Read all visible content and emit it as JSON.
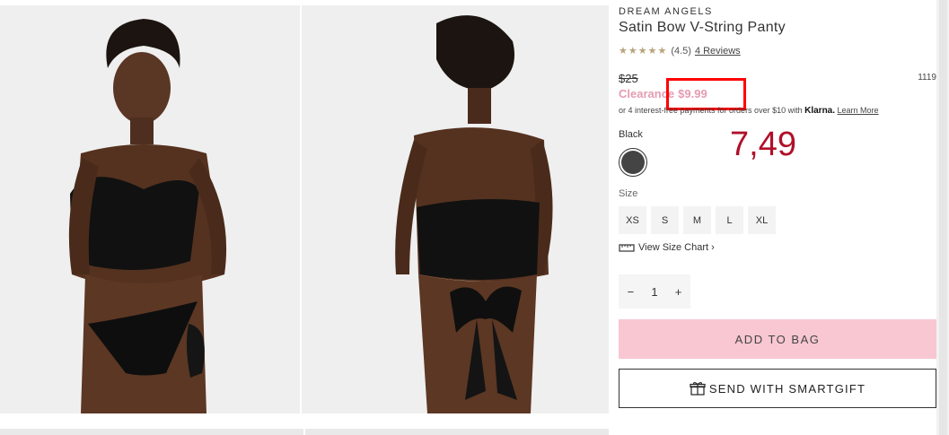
{
  "product": {
    "brand": "DREAM ANGELS",
    "title": "Satin Bow V-String Panty",
    "rating_stars": "★★★★★",
    "rating_value": "(4.5)",
    "reviews_link": "4 Reviews",
    "original_price": "$25",
    "sku": "1119",
    "clearance_label": "Clearance",
    "clearance_price": "$9.99",
    "klarna_text": "or 4 interest-free payments for orders over $10 with",
    "klarna_brand": "Klarna.",
    "klarna_link": "Learn More",
    "color_label": "Black",
    "size_label": "Size",
    "sizes": [
      "XS",
      "S",
      "M",
      "L",
      "XL"
    ],
    "size_chart_link": "View Size Chart ›",
    "quantity": "1",
    "add_to_bag": "ADD TO BAG",
    "smartgift": "SEND WITH SMARTGIFT"
  },
  "annotation": {
    "note": "7,49"
  },
  "colors": {
    "clearance": "#e59bb1",
    "add_to_bag_bg": "#f8c7d2",
    "highlight_border": "#ff0000",
    "note_text": "#b0102a"
  }
}
